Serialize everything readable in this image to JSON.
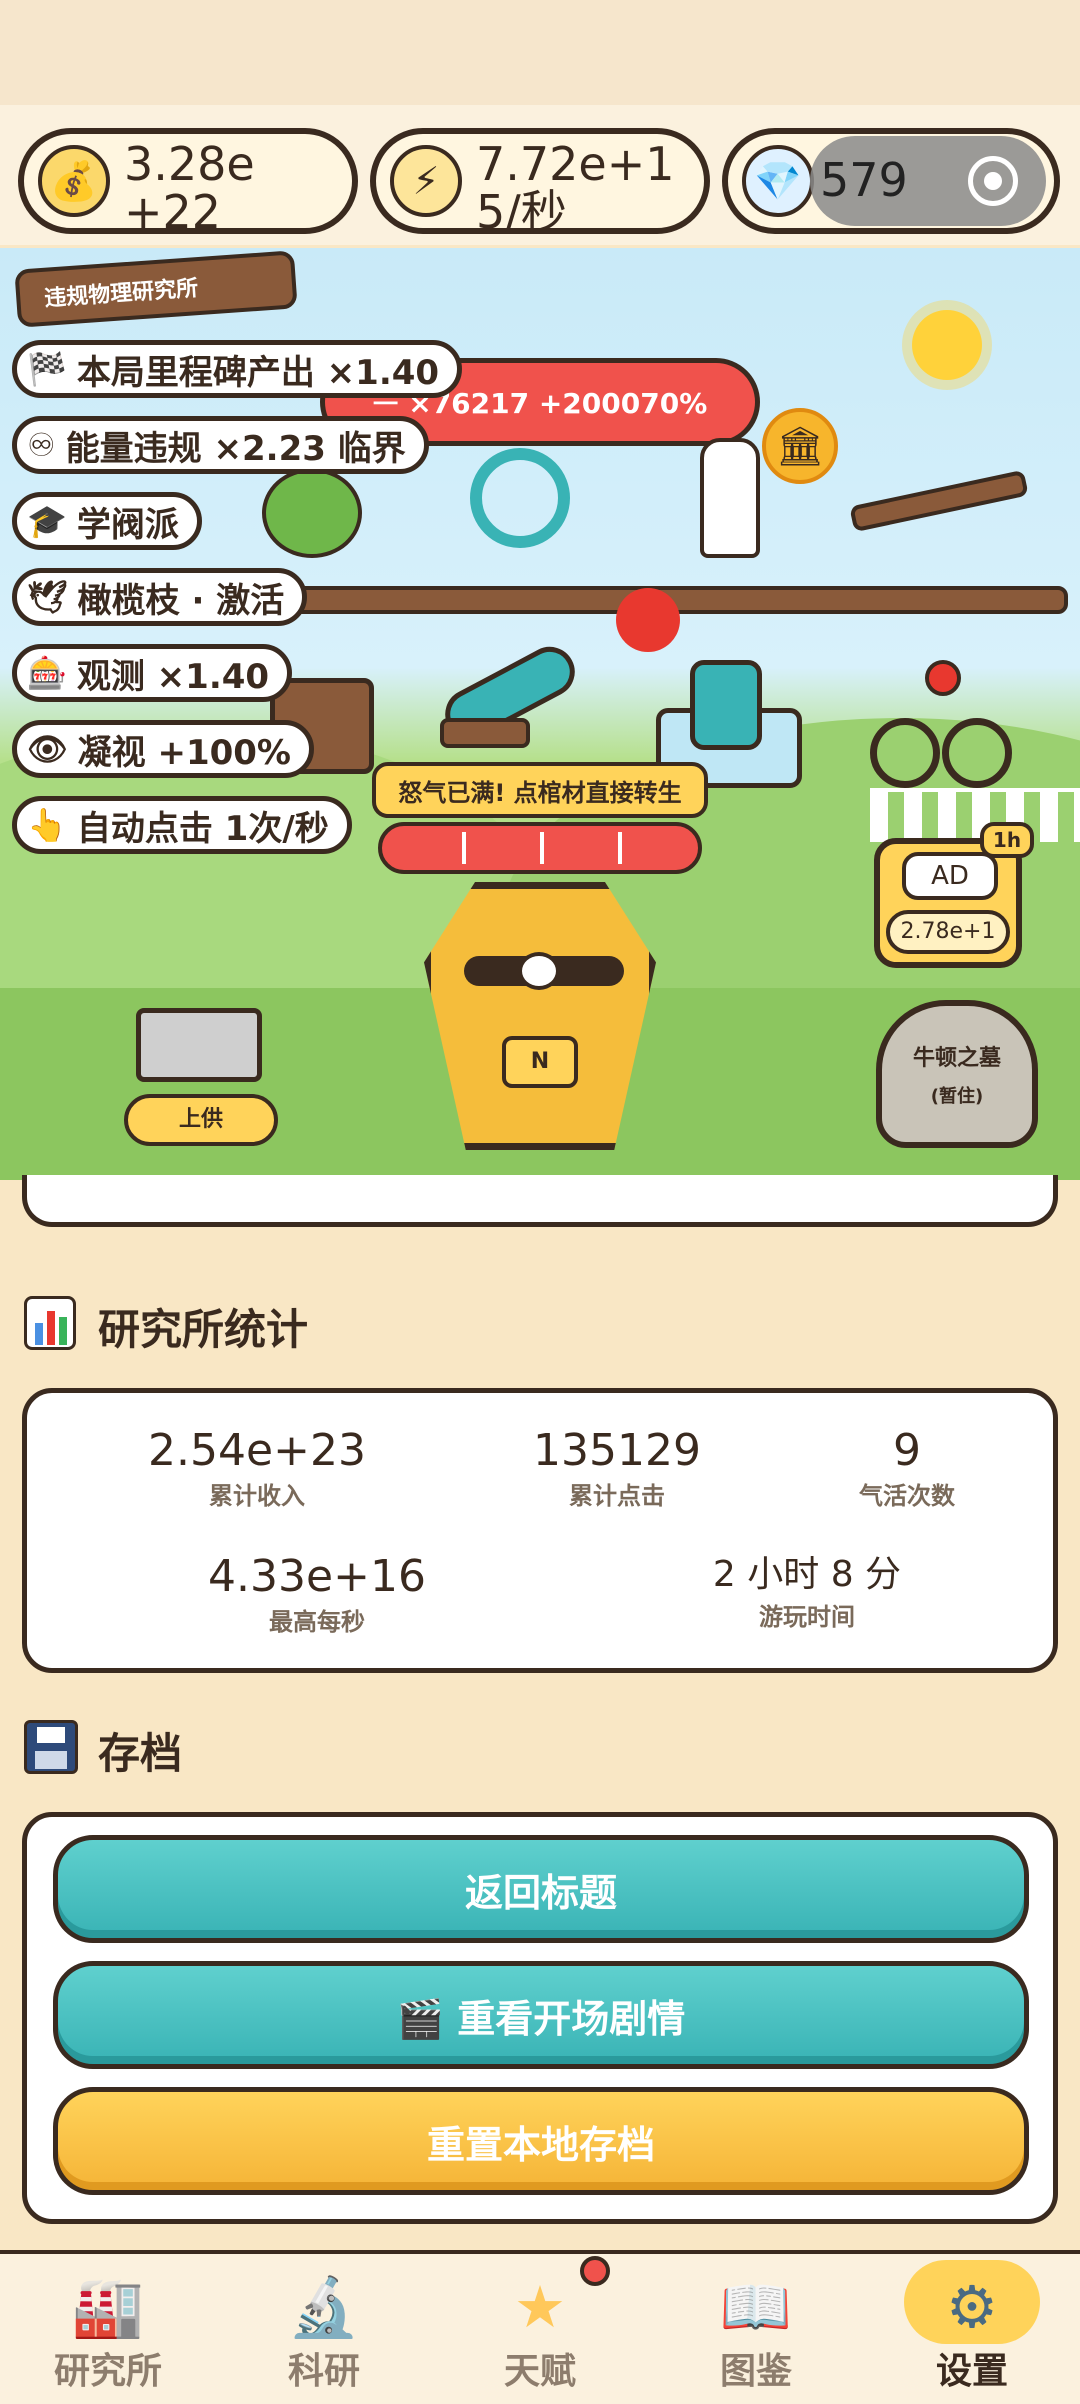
{
  "resources": {
    "money": {
      "value": "3.28e\n+22",
      "icon": "money-bag-icon"
    },
    "energy": {
      "value": "7.72e+1\n5/秒",
      "icon": "lightning-icon"
    },
    "gems": {
      "value": "579",
      "icon": "diamond-icon"
    }
  },
  "lab_sign": "违规物理研究所",
  "rage_banner": "ᅳ ×76217 +200070%",
  "buffs": [
    {
      "icon": "🏁",
      "label": "本局里程碑产出 ×1.40"
    },
    {
      "icon": "♾",
      "label": "能量违规 ×2.23 临界"
    },
    {
      "icon": "🎓",
      "label": "学阀派"
    },
    {
      "icon": "🕊",
      "label": "橄榄枝 · 激活"
    },
    {
      "icon": "🎰",
      "label": "观测 ×1.40"
    },
    {
      "icon": "👁",
      "label": "凝视 +100%"
    },
    {
      "icon": "👆",
      "label": "自动点击 1次/秒"
    }
  ],
  "rage_full_text": "怒气已满! 点棺材直接转生",
  "offer_button": "上供",
  "ad": {
    "badge": "1h",
    "label": "AD",
    "value": "2.78e+1"
  },
  "newton_tomb": {
    "title": "牛顿之墓",
    "status": "(暂住)"
  },
  "coffin_label": "N",
  "stats_section": {
    "title": "研究所统计",
    "items": [
      {
        "value": "2.54e+23",
        "label": "累计收入"
      },
      {
        "value": "135129",
        "label": "累计点击"
      },
      {
        "value": "9",
        "label": "气活次数"
      },
      {
        "value": "4.33e+16",
        "label": "最高每秒"
      },
      {
        "value": "2 小时 8 分",
        "label": "游玩时间"
      }
    ]
  },
  "save_section": {
    "title": "存档",
    "return_title": "返回标题",
    "rewatch": "🎬 重看开场剧情",
    "reset": "重置本地存档"
  },
  "nav": [
    {
      "label": "研究所",
      "icon": "factory-icon"
    },
    {
      "label": "科研",
      "icon": "microscope-icon"
    },
    {
      "label": "天赋",
      "icon": "star-icon"
    },
    {
      "label": "图鉴",
      "icon": "book-icon"
    },
    {
      "label": "设置",
      "icon": "gear-icon"
    }
  ],
  "colors": {
    "accent_teal": "#39b3b5",
    "accent_gold": "#f5b437",
    "outline": "#3a2a1f",
    "alert_red": "#f0524c"
  }
}
